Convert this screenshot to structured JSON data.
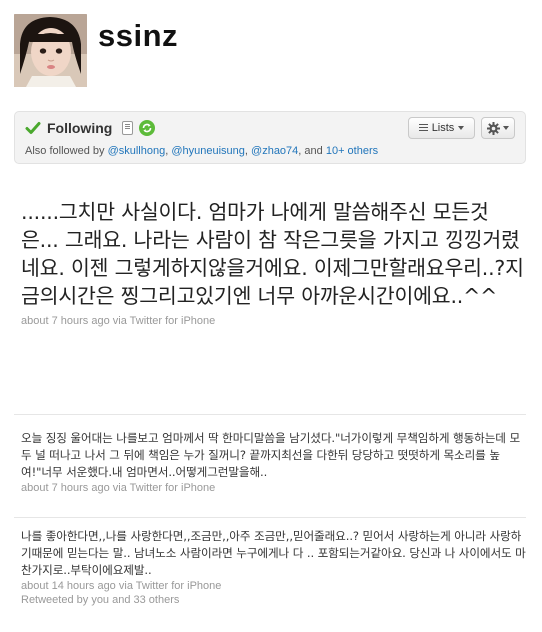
{
  "profile": {
    "username": "ssinz",
    "avatar_icon": "profile-photo"
  },
  "follow_box": {
    "status_label": "Following",
    "lists_label": "Lists",
    "also_followed_prefix": "Also followed by",
    "also_followed_users": [
      "@skullhong",
      "@hyuneuisung",
      "@zhao74"
    ],
    "also_followed_and": "and",
    "also_followed_others": "10+ others",
    "accent_color": "#2276bb",
    "check_color": "#4aa82e"
  },
  "featured_tweet": {
    "text": "......그치만 사실이다. 엄마가 나에게 말씀해주신 모든것은... 그래요. 나라는 사람이 참 작은그릇을 가지고 낑낑거렸네요. 이젠 그렇게하지않을거에요. 이제그만할래요우리..?지금의시간은 찡그리고있기엔 너무 아까운시간이에요..^^",
    "time": "about 7 hours ago",
    "via": "via",
    "source": "Twitter for iPhone"
  },
  "tweets": [
    {
      "text": "오늘 징징 울어대는 나를보고 엄마께서 딱 한마디말씀을 남기셨다.\"너가이렇게 무책임하게 행동하는데 모두 널 떠나고 나서 그 뒤에 책임은 누가 질꺼니? 끝까지최선을 다한뒤 당당하고 떳떳하게 목소리를 높여!\"너무 서운했다.내 엄마면서..어떻게그런말을해..",
      "time": "about 7 hours ago",
      "via": "via",
      "source": "Twitter for iPhone"
    },
    {
      "text": "나를 좋아한다면,,나를 사랑한다면,,조금만,,아주 조금만,,믿어줄래요..? 믿어서 사랑하는게 아니라 사랑하기때문에 믿는다는 말.. 남녀노소 사람이라면 누구에게나 다 .. 포함되는거같아요. 당신과 나 사이에서도 마찬가지로..부탁이에요제발..",
      "time": "about 14 hours ago",
      "via": "via",
      "source": "Twitter for iPhone",
      "retweeted": "Retweeted by you and 33 others"
    }
  ]
}
